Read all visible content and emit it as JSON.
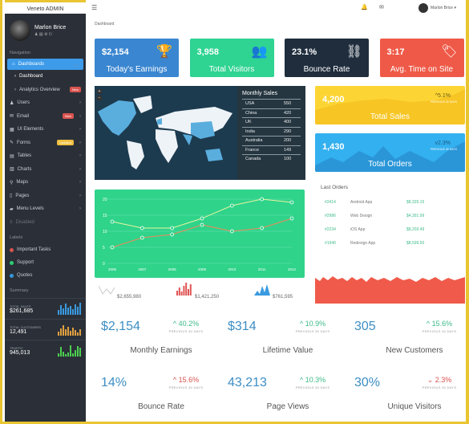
{
  "brand": "Veneto ADMIN",
  "user": {
    "name": "Marlon Brice"
  },
  "nav_heading": "Navigation",
  "nav": [
    {
      "label": "Dashboards",
      "active": true
    },
    {
      "label": "Dashboard",
      "sub": true
    },
    {
      "label": "Analytics Overview",
      "sub": true,
      "badge": "New",
      "badge_color": "#d9534f"
    },
    {
      "label": "Users"
    },
    {
      "label": "Email",
      "badge": "New",
      "badge_color": "#d9534f"
    },
    {
      "label": "UI Elements"
    },
    {
      "label": "Forms",
      "badge": "Updated",
      "badge_color": "#f0c040"
    },
    {
      "label": "Tables"
    },
    {
      "label": "Charts"
    },
    {
      "label": "Maps"
    },
    {
      "label": "Pages"
    },
    {
      "label": "Menu Levels"
    },
    {
      "label": "Disabled",
      "disabled": true
    }
  ],
  "labels_heading": "Labels",
  "labels": [
    {
      "label": "Important Tasks",
      "color": "#d9534f"
    },
    {
      "label": "Support",
      "color": "#2ecc71"
    },
    {
      "label": "Quotes",
      "color": "#3498db"
    }
  ],
  "summary_heading": "Summary",
  "summary": [
    {
      "label": "TOTAL SALES",
      "value": "$261,685",
      "color": "#3a9ae0"
    },
    {
      "label": "TOTAL CUSTOMERS",
      "value": "12,491",
      "color": "#e0a040"
    },
    {
      "label": "TRAFFIC",
      "value": "945,013",
      "color": "#4ccf50"
    }
  ],
  "header": {
    "user": "Marlon Brice ▾",
    "breadcrumb": "Dashboard"
  },
  "cards": [
    {
      "value": "$2,154",
      "label": "Today's Earnings",
      "icon": "trophy-icon",
      "color": "#3a86d1"
    },
    {
      "value": "3,958",
      "label": "Total Visitors",
      "icon": "users-icon",
      "color": "#2fd392"
    },
    {
      "value": "23.1%",
      "label": "Bounce Rate",
      "icon": "unlink-icon",
      "color": "#1f2d3d"
    },
    {
      "value": "3:17",
      "label": "Avg. Time on Site",
      "icon": "tags-icon",
      "color": "#ef5a48"
    }
  ],
  "monthly_sales": {
    "title": "Monthly Sales",
    "rows": [
      [
        "USA",
        "550"
      ],
      [
        "China",
        "420"
      ],
      [
        "UK",
        "400"
      ],
      [
        "India",
        "290"
      ],
      [
        "Australia",
        "200"
      ],
      [
        "France",
        "149"
      ],
      [
        "Canada",
        "100"
      ]
    ]
  },
  "total_sales": {
    "value": "4,200",
    "label": "Total Sales",
    "change": "^5.1%",
    "sub": "PREVIOUS 30 DAYS",
    "color": "#fcd535"
  },
  "total_orders": {
    "value": "1,430",
    "label": "Total Orders",
    "change": "v2.3%",
    "sub": "PREVIOUS 30 DAYS",
    "color": "#33b0ef"
  },
  "chart_data": {
    "type": "line",
    "categories": [
      "2006",
      "2007",
      "2008",
      "2009",
      "2010",
      "2011",
      "2012"
    ],
    "series": [
      {
        "values": [
          13,
          11,
          11,
          14,
          18,
          20,
          19
        ],
        "color": "#e8f5a0"
      },
      {
        "values": [
          5,
          8,
          9,
          12,
          10,
          11,
          14
        ],
        "color": "#f08a5d"
      }
    ],
    "ylim": [
      0,
      20
    ],
    "yticks": [
      0,
      5,
      10,
      15,
      20
    ],
    "grid": true,
    "background": "#2fd38a"
  },
  "sparks": [
    {
      "value": "$2,655,980",
      "color": "#cccccc"
    },
    {
      "value": "$1,421,250",
      "color": "#e05555"
    },
    {
      "value": "$761,595",
      "color": "#3a9ae0"
    }
  ],
  "last_orders": {
    "title": "Last Orders",
    "rows": [
      [
        "#2414",
        "Android App",
        "$8,329.15"
      ],
      [
        "#2986",
        "Web Design",
        "$4,391.99"
      ],
      [
        "#2234",
        "iOS App",
        "$8,203.49"
      ],
      [
        "#1940",
        "Redesign App",
        "$8,599.50"
      ]
    ]
  },
  "stats": [
    {
      "value": "$2,154",
      "change": "40.2%",
      "dir": "up",
      "sub": "PREVIOUS 30 DAYS",
      "label": "Monthly Earnings"
    },
    {
      "value": "$314",
      "change": "10.9%",
      "dir": "up",
      "sub": "PREVIOUS 30 DAYS",
      "label": "Lifetime Value"
    },
    {
      "value": "305",
      "change": "15.6%",
      "dir": "up",
      "sub": "PREVIOUS 30 DAYS",
      "label": "New Customers"
    },
    {
      "value": "14%",
      "change": "15.6%",
      "dir": "up-red",
      "sub": "PREVIOUS 30 DAYS",
      "label": "Bounce Rate"
    },
    {
      "value": "43,213",
      "change": "10.3%",
      "dir": "up",
      "sub": "PREVIOUS 30 DAYS",
      "label": "Page Views"
    },
    {
      "value": "30%",
      "change": "2.3%",
      "dir": "down",
      "sub": "PREVIOUS 30 DAYS",
      "label": "Unique Visitors"
    }
  ]
}
